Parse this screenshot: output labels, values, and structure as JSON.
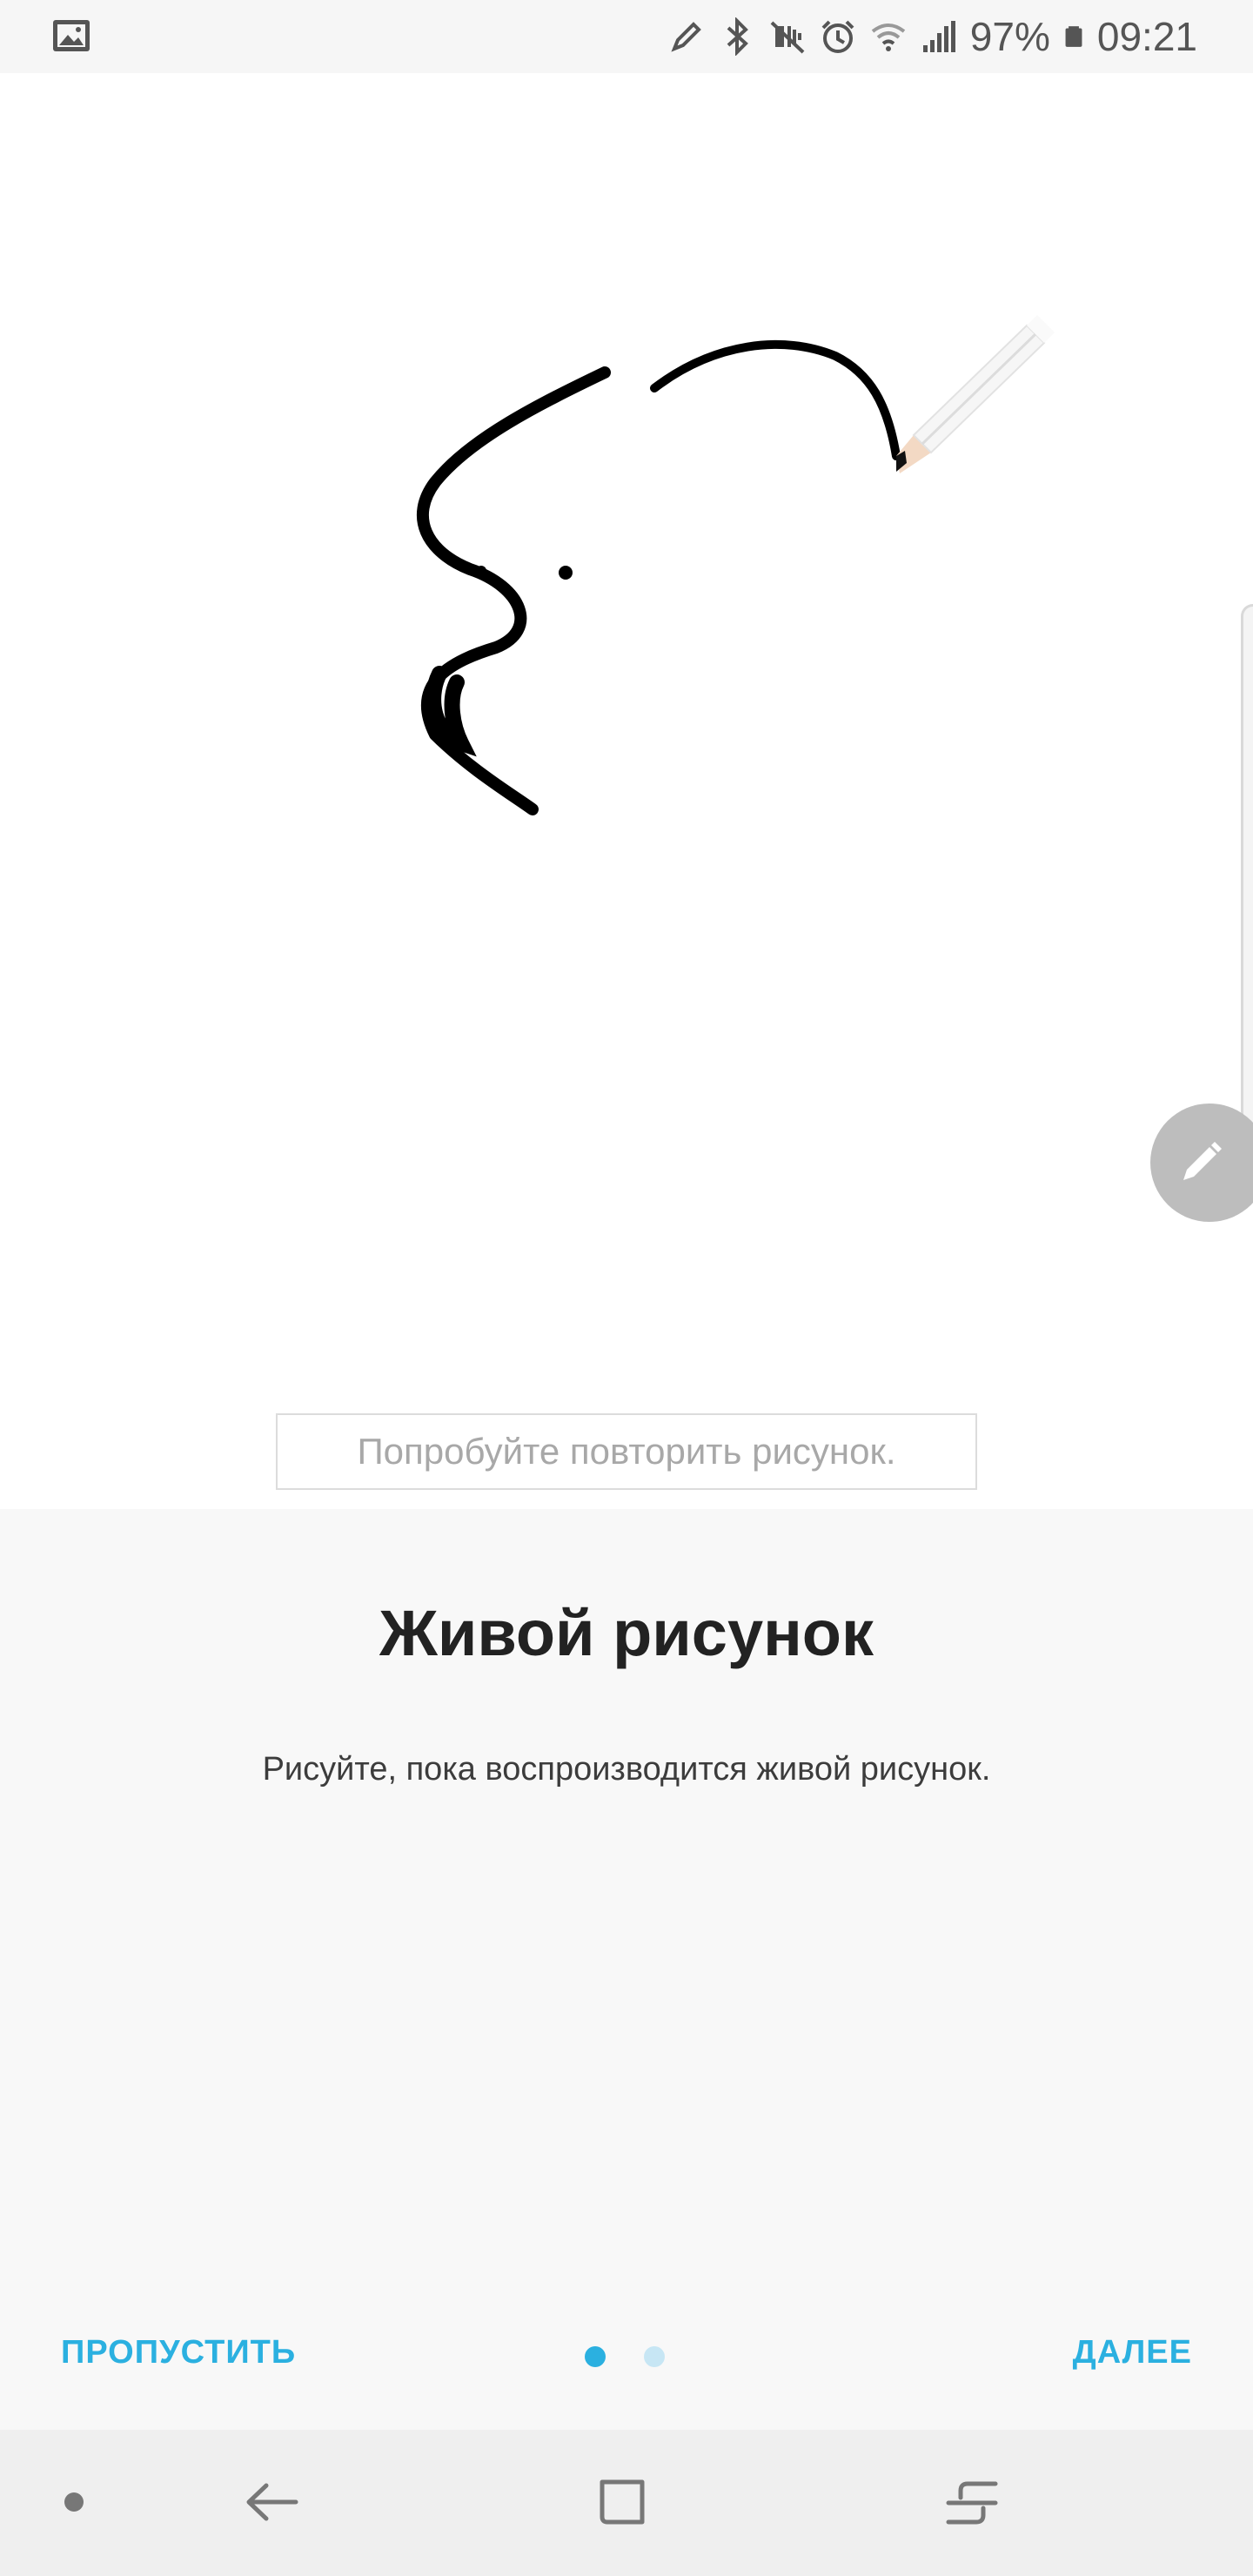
{
  "status_bar": {
    "battery": "97%",
    "time": "09:21",
    "icons": [
      "gallery-icon",
      "pen-icon",
      "bluetooth-icon",
      "mute-icon",
      "alarm-icon",
      "wifi-icon",
      "signal-icon",
      "battery-icon"
    ]
  },
  "canvas": {
    "hint": "Попробуйте повторить рисунок.",
    "fab_icon": "pen-icon"
  },
  "info": {
    "title": "Живой рисунок",
    "description": "Рисуйте, пока воспроизводится живой рисунок."
  },
  "footer": {
    "skip_label": "ПРОПУСТИТЬ",
    "next_label": "ДАЛЕЕ",
    "page_count": 2,
    "current_page": 1
  },
  "colors": {
    "accent": "#2bb0e0",
    "dot_inactive": "#c7e6f4",
    "panel_bg": "#f8f8f8",
    "nav_bg": "#efefef"
  },
  "nav_bar": {
    "icons": [
      "dot-icon",
      "back-icon",
      "home-icon",
      "recent-apps-icon"
    ]
  }
}
